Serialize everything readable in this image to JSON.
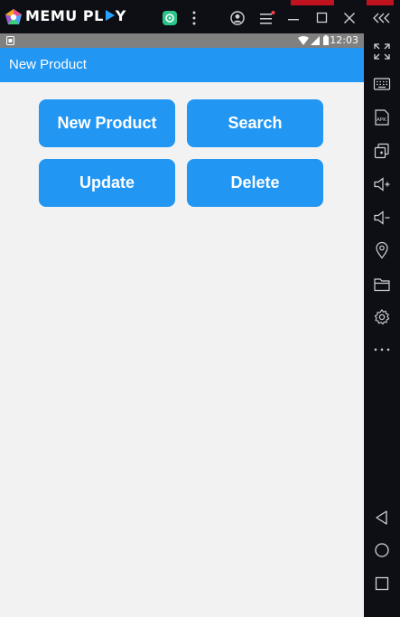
{
  "emulator": {
    "brand_left": "MEMU PL",
    "brand_right": "Y",
    "controls": [
      "collapse-arrows",
      "keyboard",
      "apk",
      "multi-window",
      "volume-up",
      "volume-down",
      "location",
      "folder",
      "settings",
      "more"
    ],
    "nav": [
      "back",
      "home",
      "recents"
    ]
  },
  "statusbar": {
    "time": "12:03"
  },
  "appbar": {
    "title": "New Product"
  },
  "buttons": {
    "new_product": "New Product",
    "search": "Search",
    "update": "Update",
    "delete": "Delete"
  },
  "colors": {
    "accent": "#2196f3",
    "background": "#f2f2f2",
    "emulator_frame": "#0d0f14"
  }
}
